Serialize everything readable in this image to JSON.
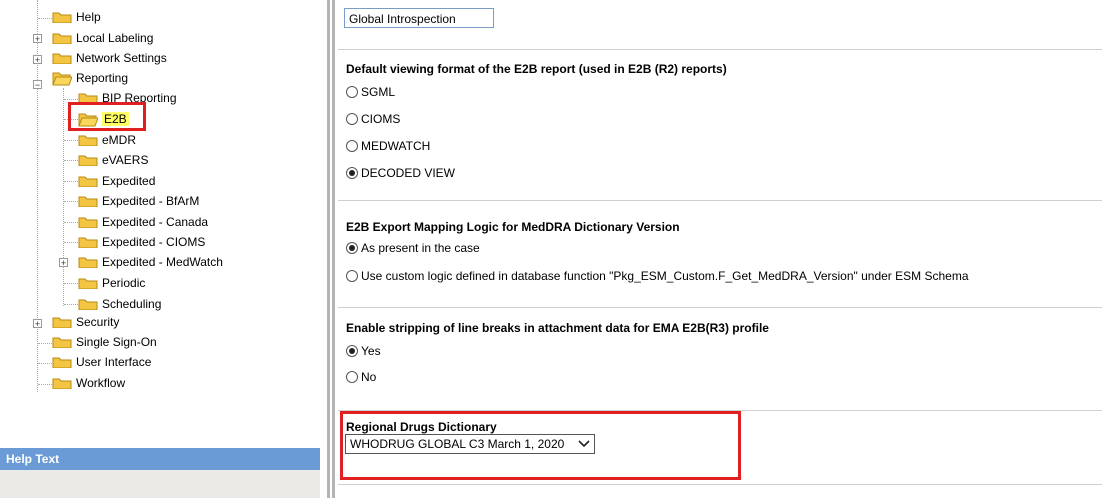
{
  "tree": {
    "items": [
      {
        "label": "Help"
      },
      {
        "label": "Local Labeling"
      },
      {
        "label": "Network Settings"
      },
      {
        "label": "Reporting"
      },
      {
        "label": "BIP Reporting"
      },
      {
        "label": "E2B"
      },
      {
        "label": "eMDR"
      },
      {
        "label": "eVAERS"
      },
      {
        "label": "Expedited"
      },
      {
        "label": "Expedited - BfArM"
      },
      {
        "label": "Expedited - Canada"
      },
      {
        "label": "Expedited - CIOMS"
      },
      {
        "label": "Expedited - MedWatch"
      },
      {
        "label": "Periodic"
      },
      {
        "label": "Scheduling"
      },
      {
        "label": "Security"
      },
      {
        "label": "Single Sign-On"
      },
      {
        "label": "User Interface"
      },
      {
        "label": "Workflow"
      }
    ]
  },
  "help_panel": {
    "title": "Help Text"
  },
  "main": {
    "top_input_value": "Global Introspection",
    "viewing_format": {
      "title": "Default viewing format of the E2B report (used in E2B (R2) reports)",
      "options": [
        "SGML",
        "CIOMS",
        "MEDWATCH",
        "DECODED VIEW"
      ],
      "selected": "DECODED VIEW"
    },
    "meddra_logic": {
      "title": "E2B Export Mapping Logic for MedDRA Dictionary Version",
      "options": [
        "As present in the case",
        "Use custom logic defined in database function \"Pkg_ESM_Custom.F_Get_MedDRA_Version\" under ESM Schema"
      ],
      "selected": "As present in the case"
    },
    "line_breaks": {
      "title": "Enable stripping of line breaks in attachment data for EMA E2B(R3) profile",
      "options": [
        "Yes",
        "No"
      ],
      "selected": "Yes"
    },
    "regional_dict": {
      "title": "Regional Drugs Dictionary",
      "value": "WHODRUG GLOBAL C3 March 1, 2020"
    }
  },
  "colors": {
    "highlight_red": "#e02020",
    "help_header": "#6a9bd6",
    "selection": "#ffff66"
  }
}
